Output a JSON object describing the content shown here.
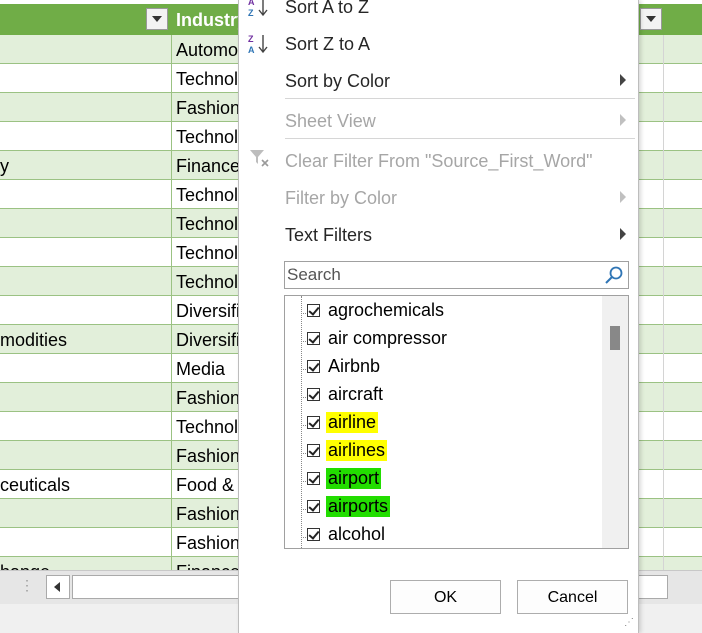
{
  "sheet": {
    "header": {
      "industry_label": "Industry"
    },
    "rows": [
      {
        "a": "",
        "b": "Automotive",
        "green": true
      },
      {
        "a": "",
        "b": "Technology",
        "green": false
      },
      {
        "a": "",
        "b": "Fashion",
        "green": true
      },
      {
        "a": "",
        "b": "Technology",
        "green": false
      },
      {
        "a": "y",
        "b": "Finance",
        "green": true
      },
      {
        "a": "",
        "b": "Technology",
        "green": false
      },
      {
        "a": "",
        "b": "Technology",
        "green": true
      },
      {
        "a": "",
        "b": "Technology",
        "green": false
      },
      {
        "a": "",
        "b": "Technology",
        "green": true
      },
      {
        "a": "",
        "b": "Diversified",
        "green": false
      },
      {
        "a": "modities",
        "b": "Diversified",
        "green": true
      },
      {
        "a": "",
        "b": "Media",
        "green": false
      },
      {
        "a": "",
        "b": "Fashion",
        "green": true
      },
      {
        "a": "",
        "b": "Technology",
        "green": false
      },
      {
        "a": "",
        "b": "Fashion",
        "green": true
      },
      {
        "a": "ceuticals",
        "b": "Food &",
        "green": false
      },
      {
        "a": "",
        "b": "Fashion",
        "green": true
      },
      {
        "a": "",
        "b": "Fashion",
        "green": false
      },
      {
        "a": "hange",
        "b": "Finance",
        "green": true
      }
    ]
  },
  "menu": {
    "sort_a_to_z": "Sort A to Z",
    "sort_z_to_a": "Sort Z to A",
    "sort_by_color": "Sort by Color",
    "sheet_view": "Sheet View",
    "clear_filter": "Clear Filter From \"Source_First_Word\"",
    "filter_by_color": "Filter by Color",
    "text_filters": "Text Filters",
    "search_placeholder": "Search",
    "items": [
      {
        "label": "agrochemicals",
        "checked": true,
        "highlight": ""
      },
      {
        "label": "air compressor",
        "checked": true,
        "highlight": ""
      },
      {
        "label": "Airbnb",
        "checked": true,
        "highlight": ""
      },
      {
        "label": "aircraft",
        "checked": true,
        "highlight": ""
      },
      {
        "label": "airline",
        "checked": true,
        "highlight": "yellow"
      },
      {
        "label": "airlines",
        "checked": true,
        "highlight": "yellow"
      },
      {
        "label": "airport",
        "checked": true,
        "highlight": "green"
      },
      {
        "label": "airports",
        "checked": true,
        "highlight": "green"
      },
      {
        "label": "alcohol",
        "checked": true,
        "highlight": ""
      }
    ],
    "ok": "OK",
    "cancel": "Cancel"
  },
  "colors": {
    "header_green": "#70ad47",
    "band_green": "#e2efda",
    "highlight_yellow": "#ffff00",
    "highlight_green": "#22dd00"
  }
}
